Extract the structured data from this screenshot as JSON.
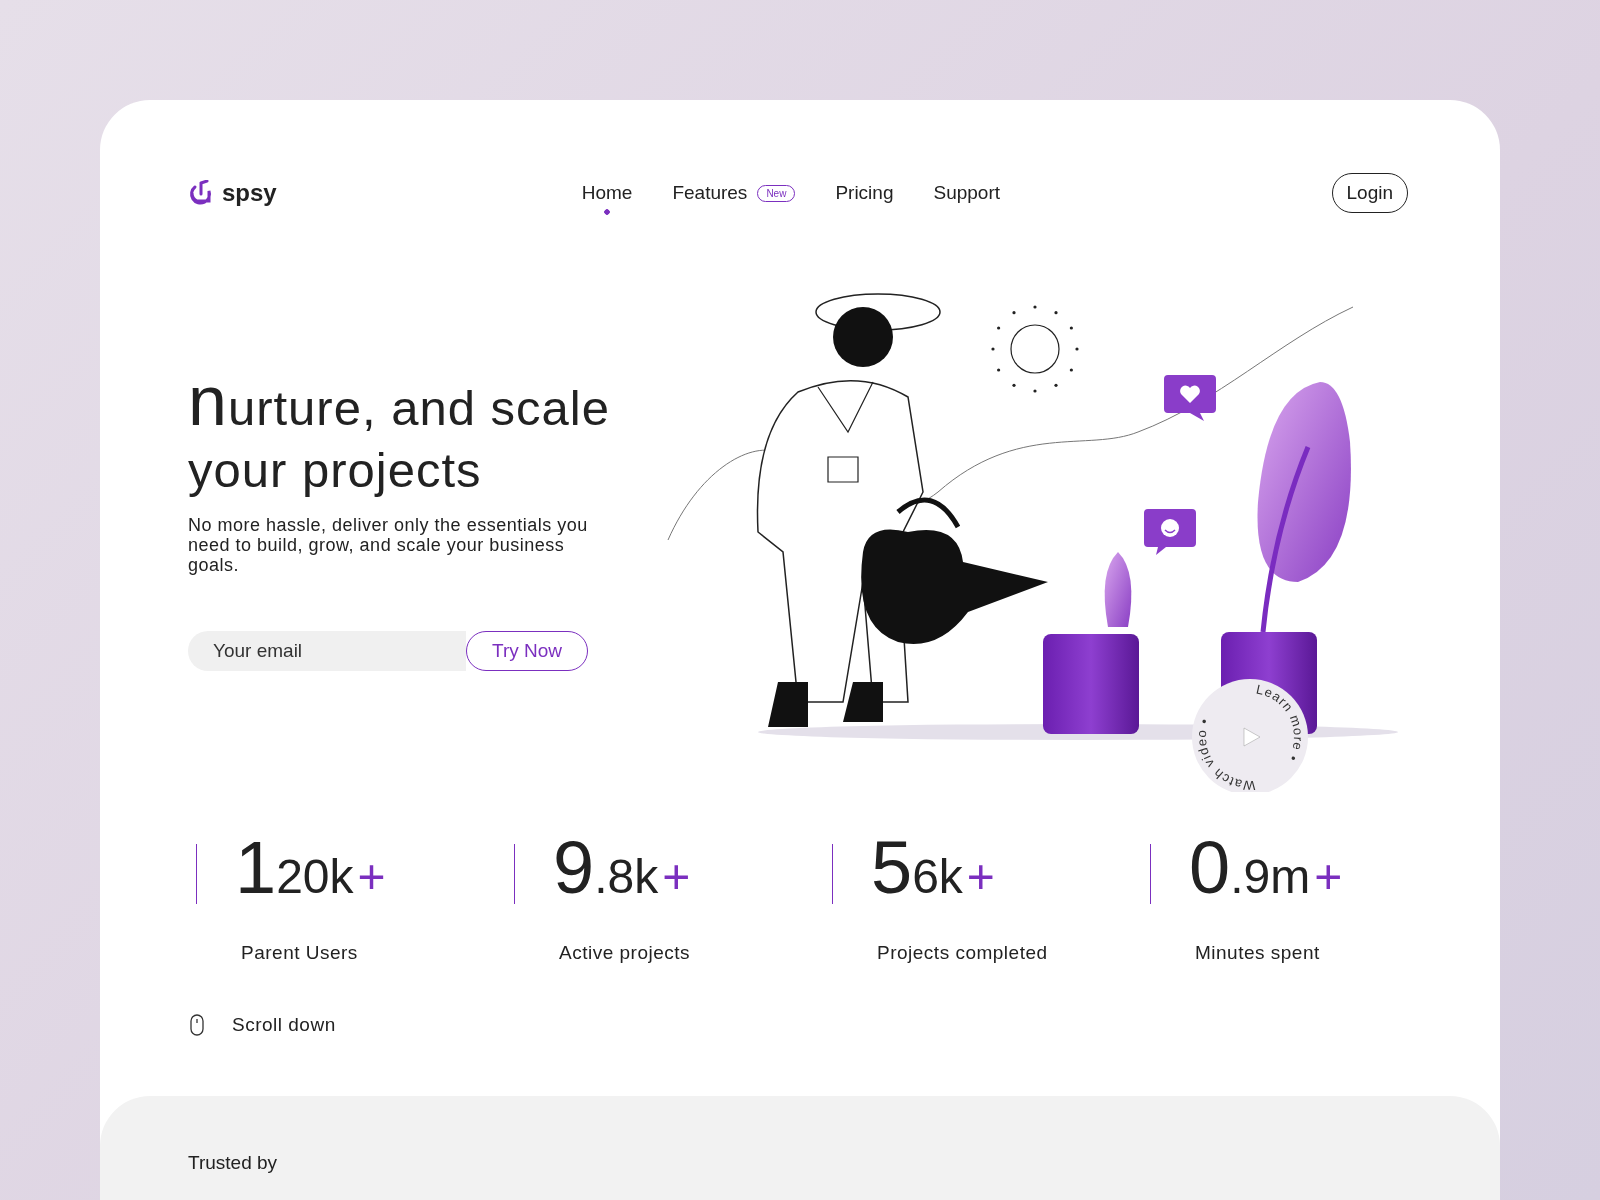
{
  "brand": {
    "name": "spsy"
  },
  "nav": [
    {
      "label": "Home",
      "selected": true
    },
    {
      "label": "Features",
      "selected": false,
      "badge": "New"
    },
    {
      "label": "Pricing",
      "selected": false
    },
    {
      "label": "Support",
      "selected": false
    }
  ],
  "login": "Login",
  "hero": {
    "heading_lead": "n",
    "heading_rest": "urture, and scale your projects",
    "text": "No more hassle, deliver only the essentials you need to build, grow, and scale your business goals.",
    "email_placeholder": "Your email",
    "cta": "Try Now"
  },
  "video_badge": {
    "top_text": "Learn more •",
    "bottom_text": "Watch video •"
  },
  "stats": [
    {
      "lead": "1",
      "rest": "20k",
      "suffix": "+",
      "label": "Parent Users"
    },
    {
      "lead": "9",
      "rest": ".8k",
      "suffix": "+",
      "label": "Active projects"
    },
    {
      "lead": "5",
      "rest": "6k",
      "suffix": "+",
      "label": "Projects completed"
    },
    {
      "lead": "0",
      "rest": ".9m",
      "suffix": "+",
      "label": "Minutes spent"
    }
  ],
  "scroll": "Scroll down",
  "trusted": "Trusted by"
}
